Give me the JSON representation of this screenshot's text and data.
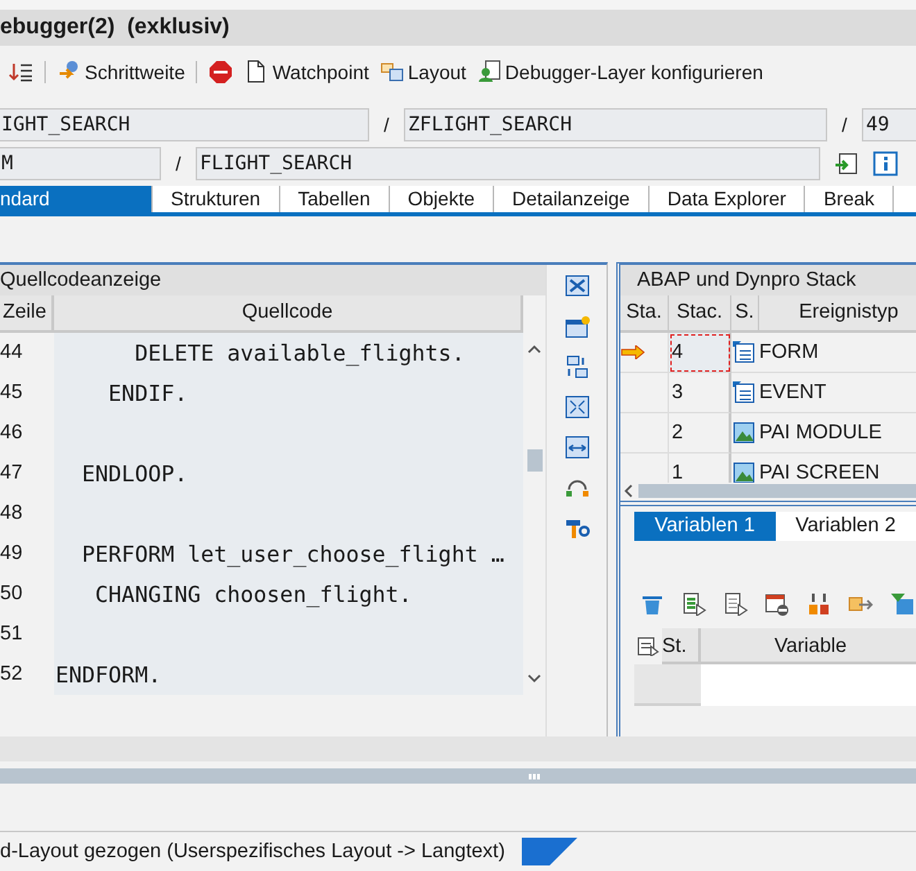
{
  "window": {
    "title": "ebugger(2)  (exklusiv)"
  },
  "toolbar": [
    {
      "label": "Schrittweite"
    },
    {
      "label": "Watchpoint"
    },
    {
      "label": "Layout"
    },
    {
      "label": "Debugger-Layer  konfigurieren"
    }
  ],
  "fields_row_1": [
    {
      "kind": "field",
      "value": "IGHT_SEARCH"
    },
    {
      "kind": "separator",
      "value": "/"
    },
    {
      "kind": "field",
      "value": "ZFLIGHT_SEARCH"
    },
    {
      "kind": "separator",
      "value": "/"
    },
    {
      "kind": "field",
      "value": "49"
    }
  ],
  "fields_row_2": [
    {
      "kind": "field",
      "value": "M"
    },
    {
      "kind": "separator",
      "value": "/"
    },
    {
      "kind": "field",
      "value": "FLIGHT_SEARCH"
    }
  ],
  "tabs": [
    {
      "label": "ndard",
      "selected": true
    },
    {
      "label": "Strukturen",
      "selected": false
    },
    {
      "label": "Tabellen",
      "selected": false
    },
    {
      "label": "Objekte",
      "selected": false
    },
    {
      "label": "Detailanzeige",
      "selected": false
    },
    {
      "label": "Data Explorer",
      "selected": false
    },
    {
      "label": "Break",
      "selected": false
    }
  ],
  "source": {
    "title": "Quellcodeanzeige",
    "columns": [
      "Zeile",
      "Quellcode"
    ],
    "rows": [
      {
        "line": "44",
        "code": "      DELETE available_flights."
      },
      {
        "line": "45",
        "code": "    ENDIF."
      },
      {
        "line": "46"
      },
      {
        "line": "47",
        "code": "  ENDLOOP."
      },
      {
        "line": "48"
      },
      {
        "line": "49",
        "code": "  PERFORM let_user_choose_flight …"
      },
      {
        "line": "50",
        "code": "   CHANGING choosen_flight."
      },
      {
        "line": "51"
      },
      {
        "line": "52",
        "code": "ENDFORM."
      }
    ]
  },
  "stack": {
    "title": "ABAP und Dynpro Stack",
    "columns": [
      "Sta.",
      "Stac.",
      "S.",
      "Ereignistyp"
    ],
    "rows": [
      {
        "level": "4",
        "kind": "program",
        "event": "FORM",
        "current": true,
        "selected": true
      },
      {
        "level": "3",
        "kind": "program",
        "event": "EVENT",
        "current": false,
        "selected": false
      },
      {
        "level": "2",
        "kind": "screen",
        "event": "PAI MODULE",
        "current": false,
        "selected": false
      },
      {
        "level": "1",
        "kind": "screen",
        "event": "PAI SCREEN",
        "current": false,
        "selected": false
      }
    ]
  },
  "variables": {
    "tabs": [
      {
        "label": "Variablen 1",
        "selected": true
      },
      {
        "label": "Variablen 2",
        "selected": false
      }
    ],
    "columns": [
      "St.",
      "Variable"
    ]
  },
  "status_bar": {
    "message": "d-Layout gezogen (Userspezifisches Layout -> Langtext)"
  }
}
